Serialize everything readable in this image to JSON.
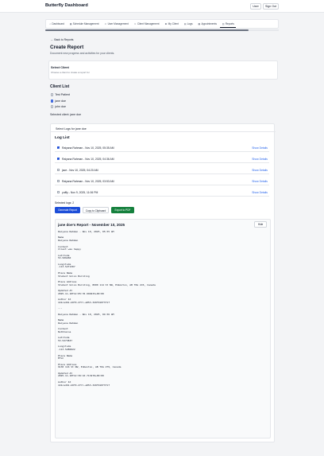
{
  "header": {
    "brand": "Butterfly Dashboard",
    "user_label": "User",
    "signout_label": "Sign Out"
  },
  "tabs": [
    {
      "label": "Dashboard",
      "icon": "home-icon"
    },
    {
      "label": "Schedule Management",
      "icon": "calendar-icon"
    },
    {
      "label": "User Management",
      "icon": "users-icon"
    },
    {
      "label": "Client Management",
      "icon": "users-icon"
    },
    {
      "label": "My Client",
      "icon": "user-icon"
    },
    {
      "label": "Logs",
      "icon": "document-icon"
    },
    {
      "label": "Appointments",
      "icon": "calendar-icon"
    },
    {
      "label": "Reports",
      "icon": "report-icon"
    }
  ],
  "page": {
    "back_label": "Back to Reports",
    "title": "Create Report",
    "subtitle": "Document new progress and activities for your clients."
  },
  "select_client": {
    "label": "Select Client",
    "hint": "Choose a client to create a report for"
  },
  "client_list": {
    "title": "Client List",
    "clients": [
      {
        "name": "Test Patient",
        "selected": false
      },
      {
        "name": "jane doe",
        "selected": true
      },
      {
        "name": "john doe",
        "selected": false
      }
    ],
    "selected_text": "Selected client: jane doe"
  },
  "logs": {
    "header": "Select Logs for jane doe",
    "list_title": "Log List",
    "items": [
      {
        "text": "Raiyana Rahman - Nov 10, 2025, 05:35 AM",
        "checked": true,
        "action": "Show Details"
      },
      {
        "text": "Raiyana Rahman - Nov 10, 2025, 04:36 AM",
        "checked": true,
        "action": "Show Details"
      },
      {
        "text": "jace - Nov 10, 2025, 04:20 AM",
        "checked": false,
        "action": "Show Details"
      },
      {
        "text": "Raiyana Rahman - Nov 10, 2025, 03:53 AM",
        "checked": false,
        "action": "Show Details"
      },
      {
        "text": "yuffiy - Nov 9, 2025, 11:06 PM",
        "checked": false,
        "action": "Show Details"
      }
    ],
    "selected_count": "Selected logs: 2",
    "generate_label": "Generate Report",
    "copy_label": "Copy to Clipboard",
    "export_label": "Export to PDF"
  },
  "report": {
    "title": "jane doe's Report - November 10, 2025",
    "hide_label": "Hide",
    "body": "Raiyana Rahman - Nov 10, 2025, 05:35 AM\n\nName\nRaiyana Rahman\n\nContent\nClient was happy\n\nLatitude\n53.509260\n\nLongitude\n-113.5271307\n\nPlace Name\nStudent Union Building\n\nPlace Address\nStudent Union Building, 8900 114 St NW, Edmonton, AB T6G 2J6, Canada\n\nUpdated At\n2025-11-10T12:05:35.999233+00:00\n\nAuthor Id\n4d1ced61-b0f9-4f7c-a853-349f910f3f1f\n\n---\n\nRaiyana Rahman - Nov 10, 2025, 04:36 AM\n\nName\nRaiyana Rahman\n\nContent\nNothhaina\n\nLatitude\n53.5273837\n\nLongitude\n-113.5286022\n\nPlace Name\nETLC\n\nPlace Address\n9130 116 St NW, Edmonton, AB T6G 2T9, Canada\n\nUpdated At\n2025-11-10T12:36:10.713270+00:00\n\nAuthor Id\n4d1ced61-b0f9-4f7c-a853-349f910f3f1f"
  }
}
